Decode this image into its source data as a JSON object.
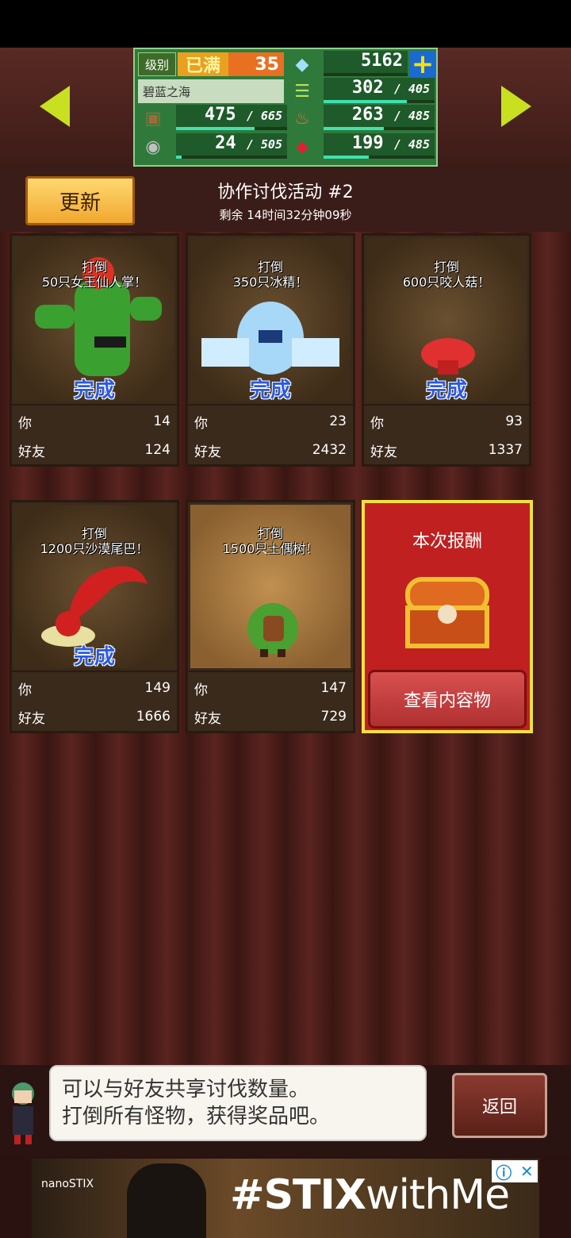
{
  "top": {
    "level_label": "级别",
    "level_max": "已满",
    "level_value": "35",
    "gems": "5162",
    "area_name": "碧蓝之海",
    "resources": [
      {
        "icon": "grass-icon",
        "value": "302",
        "max": "405",
        "fill": 0.75
      },
      {
        "icon": "wood-icon",
        "value": "475",
        "max": "665",
        "fill": 0.71
      },
      {
        "icon": "food-icon",
        "value": "263",
        "max": "485",
        "fill": 0.54
      },
      {
        "icon": "ore-icon",
        "value": "24",
        "max": "505",
        "fill": 0.05
      },
      {
        "icon": "ruby-icon",
        "value": "199",
        "max": "485",
        "fill": 0.41
      }
    ]
  },
  "header": {
    "refresh_label": "更新",
    "title": "协作讨伐活动 #2",
    "time_left": "剩余 14时间32分钟09秒"
  },
  "cards": [
    {
      "goal_line1": "打倒",
      "goal_line2": "50只女王仙人掌！",
      "done": "完成",
      "you_label": "你",
      "you_value": "14",
      "friend_label": "好友",
      "friend_value": "124",
      "monster": "cactus-queen-icon"
    },
    {
      "goal_line1": "打倒",
      "goal_line2": "350只冰精！",
      "done": "完成",
      "you_label": "你",
      "you_value": "23",
      "friend_label": "好友",
      "friend_value": "2432",
      "monster": "ice-spirit-icon"
    },
    {
      "goal_line1": "打倒",
      "goal_line2": "600只咬人菇！",
      "done": "完成",
      "you_label": "你",
      "you_value": "93",
      "friend_label": "好友",
      "friend_value": "1337",
      "monster": "mushroom-icon"
    },
    {
      "goal_line1": "打倒",
      "goal_line2": "1200只沙漠尾巴！",
      "done": "完成",
      "you_label": "你",
      "you_value": "149",
      "friend_label": "好友",
      "friend_value": "1666",
      "monster": "desert-tail-icon"
    },
    {
      "goal_line1": "打倒",
      "goal_line2": "1500只土偶树！",
      "done": "",
      "you_label": "你",
      "you_value": "147",
      "friend_label": "好友",
      "friend_value": "729",
      "monster": "clay-tree-icon"
    }
  ],
  "reward": {
    "title": "本次报酬",
    "button": "查看内容物"
  },
  "bottom": {
    "message_line1": "可以与好友共享讨伐数量。",
    "message_line2": "打倒所有怪物，获得奖品吧。",
    "back_label": "返回"
  },
  "ad": {
    "brand": "nanoSTIX",
    "hashtag_bold": "#STIX",
    "hashtag_rest": "withMe",
    "close": "✕",
    "info": "ⓘ"
  }
}
